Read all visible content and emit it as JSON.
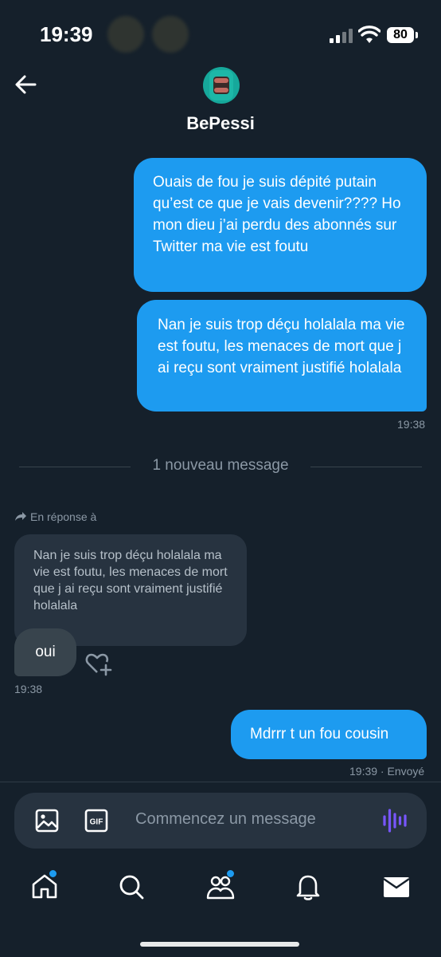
{
  "status_bar": {
    "time": "19:39",
    "battery": "80"
  },
  "header": {
    "contact_name": "BePessi"
  },
  "messages": {
    "out1": "Ouais de fou je suis dépité putain qu’est ce que je vais devenir???? Ho mon dieu j’ai perdu des abonnés sur Twitter ma vie est foutu",
    "out2": "Nan je suis trop déçu holalala ma vie est foutu, les menaces de mort que j ai reçu sont vraiment justifié holalala",
    "out2_time": "19:38",
    "new_divider": "1 nouveau message",
    "reply_label": "En réponse à",
    "quoted_text": "Nan je suis trop déçu holalala ma vie est foutu, les menaces de mort que j ai reçu sont vraiment justifié holalala",
    "in1": "oui",
    "in1_time": "19:38",
    "out3": "Mdrrr t un fou cousin",
    "out3_time": "19:39 · Envoyé"
  },
  "composer": {
    "placeholder": "Commencez un message"
  },
  "icons": {
    "back": "arrow-left-icon",
    "image": "image-icon",
    "gif": "gif-icon",
    "voice": "voice-wave-icon",
    "home": "home-icon",
    "search": "search-icon",
    "communities": "communities-icon",
    "notifications": "bell-icon",
    "messages": "mail-icon"
  },
  "colors": {
    "accent": "#1d9bf0",
    "background": "#15202b",
    "voice": "#7856ff"
  }
}
